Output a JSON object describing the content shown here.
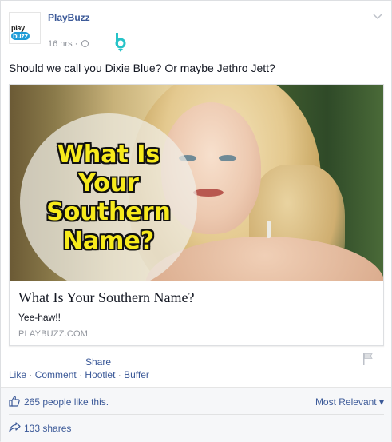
{
  "post": {
    "page_name": "PlayBuzz",
    "avatar_logo_prefix": "play",
    "avatar_logo_suffix": "buzz",
    "timestamp": "16 hrs",
    "timestamp_sep": "·",
    "text": "Should we call you Dixie Blue? Or maybe Jethro Jett?"
  },
  "link_card": {
    "image_headline": [
      "What Is",
      "Your",
      "Southern",
      "Name?"
    ],
    "title": "What Is Your Southern Name?",
    "description": "Yee-haw!!",
    "domain": "PLAYBUZZ.COM"
  },
  "actions": {
    "share": "Share",
    "like": "Like",
    "comment": "Comment",
    "hootlet": "Hootlet",
    "buffer": "Buffer",
    "sep": "·"
  },
  "footer": {
    "likes": "265 people like this.",
    "sort": "Most Relevant",
    "shares": "133 shares"
  },
  "colors": {
    "link_blue": "#3b5998",
    "meta_gray": "#90949c",
    "headline_yellow": "#f7ea1c",
    "b_icon_teal": "#26c3c8"
  },
  "icons": {
    "globe": "globe-icon",
    "b_extension": "b-extension-icon",
    "chevron": "chevron-down-icon",
    "flag": "flag-icon",
    "thumb": "thumbs-up-icon",
    "share": "share-arrow-icon",
    "sort_caret": "caret-down-icon"
  }
}
